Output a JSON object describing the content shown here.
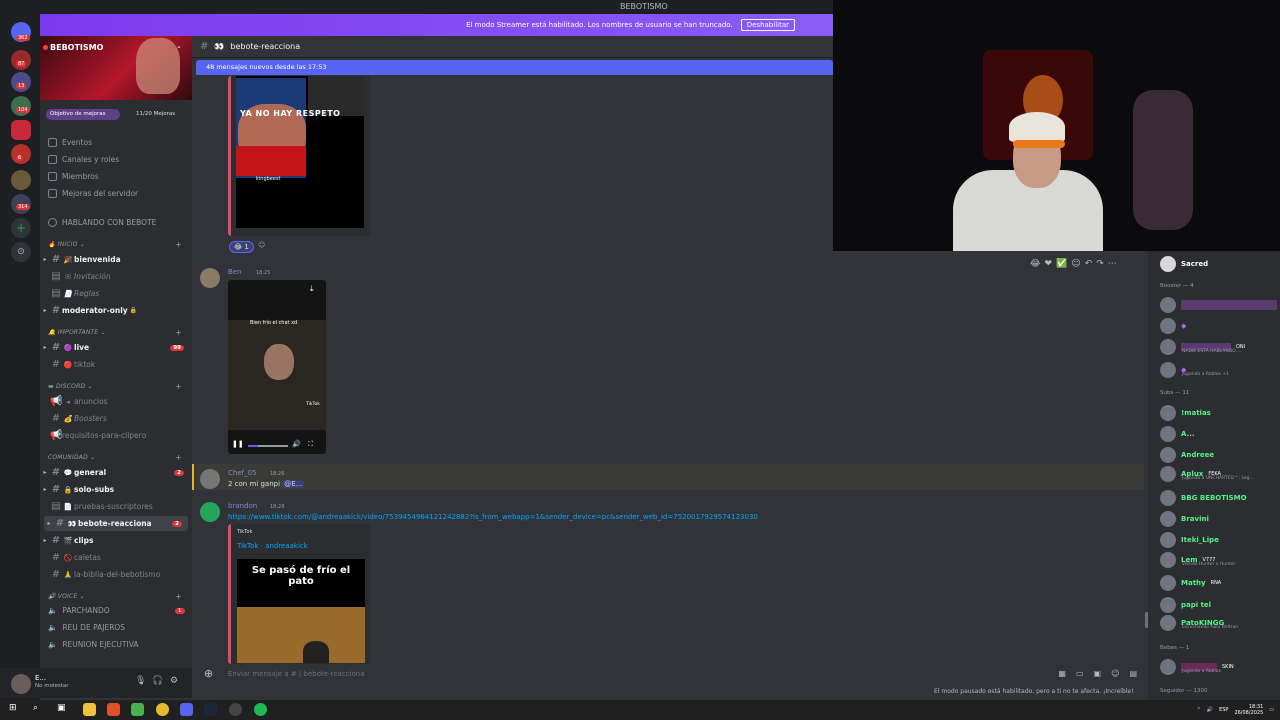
{
  "window": {
    "server_title": "BEBOTISMO",
    "streamer_banner": "El modo Streamer está habilitado. Los nombres de usuario se han truncado.",
    "streamer_disable": "Deshabilitar"
  },
  "server": {
    "name": "BEBOTISMO",
    "boost_goal": "Objetivo de mejoras",
    "boost_count": "11/20 Mejoras",
    "rail_badges": [
      "362",
      "87",
      "13",
      "104",
      "6",
      "314"
    ]
  },
  "menu_items": [
    "Eventos",
    "Canales y roles",
    "Miembros",
    "Mejoras del servidor"
  ],
  "voice_header": "HABLANDO CON BEBOTE",
  "categories": {
    "inicio": "INICIO",
    "importante": "IMPORTANTE",
    "discord": "DISCORD",
    "comunidad": "COMUNIDAD",
    "voice": "VOICE"
  },
  "channels": {
    "bienvenida": "bienvenida",
    "invitacion": "Invitación",
    "reglas": "Reglas",
    "moderator_only": "moderator-only",
    "live": "live",
    "live_badge": "99",
    "tiktok": "tiktok",
    "anuncios": "anuncios",
    "boosters": "Boosters",
    "requisitos": "requisitos-para-clipero",
    "general": "general",
    "general_badge": "2",
    "solo_subs": "solo-subs",
    "pruebas": "pruebas-suscriptores",
    "bebote": "bebote-reacciona",
    "bebote_badge": "2",
    "clips": "clips",
    "caletas": "caletas",
    "biblia": "la-biblia-del-bebotismo"
  },
  "voice_channels": {
    "parchando": "PARCHANDO",
    "parchando_badge": "1",
    "reu": "REU DE PAJEROS",
    "reunion": "REUNION EJECUTIVA"
  },
  "user": {
    "name": "E...",
    "status": "No molestar"
  },
  "chat": {
    "channel": "bebote-reacciona",
    "new_messages": "48 mensajes nuevos desde las 17:53",
    "embed1_overlay": "YA NO HAY RESPETO",
    "embed1_user": "kingbeest",
    "reaction_count": "1",
    "msg1_user": "Ben",
    "msg1_time": "18:25",
    "video_caption": "Bien frío el chat xd",
    "video_brand": "TikTok",
    "msg2_user": "Chef_05",
    "msg2_time": "18:26",
    "msg2_text": "2 con mi ganpi",
    "msg2_mention": "@E...",
    "msg3_user": "brandon",
    "msg3_time": "18:28",
    "msg3_link": "https://www.tiktok.com/@andreaakick/video/7539454964121242882?is_from_webapp=1&sender_device=pc&sender_web_id=7520017929574123030",
    "embed3_provider": "TikTok",
    "embed3_title": "TikTok · andreaakick",
    "embed3_caption": "Se pasó de frío el pato",
    "composer_placeholder": "Enviar mensaje a # | bebote-reacciona",
    "paused_notice": "El modo pausado está habilitado, pero a ti no te afecta. ¡Increíble!"
  },
  "members": {
    "top": "Sacred",
    "group_booster": "Booster — 4",
    "booster_status1": "NADIE ESTÁ HABLANDO ...",
    "booster_status2": "Jugando a Roblox +1",
    "booster_tag": "ONI",
    "group_subs": "Subs — 11",
    "subs": [
      {
        "name": "!matias",
        "color": "#57f287",
        "status": ""
      },
      {
        "name": "A...",
        "color": "#57f287",
        "status": ""
      },
      {
        "name": "Andreee",
        "color": "#57f287",
        "status": ""
      },
      {
        "name": "Aplux",
        "color": "#57f287",
        "status": "Jugando a UNCHARTED™: Leg..."
      },
      {
        "name": "BBG BEBOTISMO",
        "color": "#57f287",
        "status": ""
      },
      {
        "name": "Bravini",
        "color": "#57f287",
        "status": ""
      },
      {
        "name": "Iteki_Lipe",
        "color": "#57f287",
        "status": ""
      },
      {
        "name": "Lem",
        "color": "#57f287",
        "status": "Viendo Hunter x Hunter"
      },
      {
        "name": "Mathy",
        "color": "#57f287",
        "status": ""
      },
      {
        "name": "papi tel",
        "color": "#57f287",
        "status": ""
      },
      {
        "name": "PatoKINGG",
        "color": "#57f287",
        "status": "Escuchando Raúl Beltran"
      }
    ],
    "aplux_tag": "FEKA",
    "lem_tag": "V777",
    "mathy_tag": "RNA",
    "group_bebes": "Bebes — 1",
    "bebe_tag": "SKIN",
    "bebe_status": "Jugando a Roblox",
    "group_seguidor": "Seguidor — 1300"
  },
  "taskbar": {
    "time": "18:31",
    "date": "26/08/2025",
    "lang": "ESP"
  }
}
